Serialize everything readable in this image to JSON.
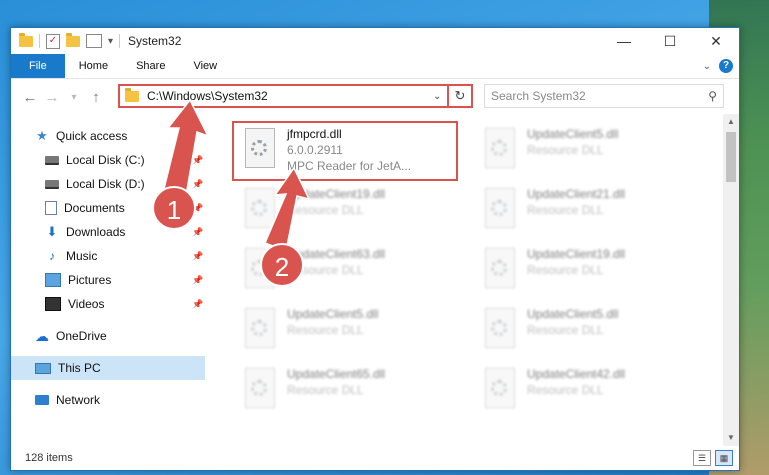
{
  "window": {
    "title": "System32",
    "minimize_glyph": "—",
    "maximize_glyph": "☐",
    "close_glyph": "✕"
  },
  "ribbon": {
    "tabs": [
      "File",
      "Home",
      "Share",
      "View"
    ],
    "help": "?"
  },
  "address": {
    "path": "C:\\Windows\\System32",
    "search_placeholder": "Search System32"
  },
  "sidebar": {
    "items": [
      {
        "label": "Quick access",
        "icon": "star-icon"
      },
      {
        "label": "Local Disk (C:)",
        "icon": "disk-icon",
        "pinned": true
      },
      {
        "label": "Local Disk (D:)",
        "icon": "disk-icon",
        "pinned": true
      },
      {
        "label": "Documents",
        "icon": "document-icon",
        "pinned": true
      },
      {
        "label": "Downloads",
        "icon": "download-icon",
        "pinned": true
      },
      {
        "label": "Music",
        "icon": "music-icon",
        "pinned": true
      },
      {
        "label": "Pictures",
        "icon": "pictures-icon",
        "pinned": true
      },
      {
        "label": "Videos",
        "icon": "videos-icon",
        "pinned": true
      },
      {
        "label": "OneDrive",
        "icon": "cloud-icon"
      },
      {
        "label": "This PC",
        "icon": "computer-icon",
        "selected": true
      },
      {
        "label": "Network",
        "icon": "network-icon"
      }
    ]
  },
  "files": [
    {
      "name": "jfmpcrd.dll",
      "line2": "6.0.0.2911",
      "line3": "MPC Reader for JetA...",
      "highlighted": true
    },
    {
      "name": "UpdateClient5.dll",
      "line2": "Resource DLL"
    },
    {
      "name": "UpdateClient19.dll",
      "line2": "Resource DLL"
    },
    {
      "name": "UpdateClient21.dll",
      "line2": "Resource DLL"
    },
    {
      "name": "UpdateClient63.dll",
      "line2": "Resource DLL"
    },
    {
      "name": "UpdateClient19.dll",
      "line2": "Resource DLL"
    },
    {
      "name": "UpdateClient5.dll",
      "line2": "Resource DLL"
    },
    {
      "name": "UpdateClient5.dll",
      "line2": "Resource DLL"
    },
    {
      "name": "UpdateClient65.dll",
      "line2": "Resource DLL"
    },
    {
      "name": "UpdateClient42.dll",
      "line2": "Resource DLL"
    }
  ],
  "status": {
    "items": "128 items"
  },
  "annotations": {
    "step1": "1",
    "step2": "2"
  },
  "colors": {
    "accent": "#1979ca",
    "highlight": "#d9534f",
    "selected_bg": "#cce4f7"
  }
}
